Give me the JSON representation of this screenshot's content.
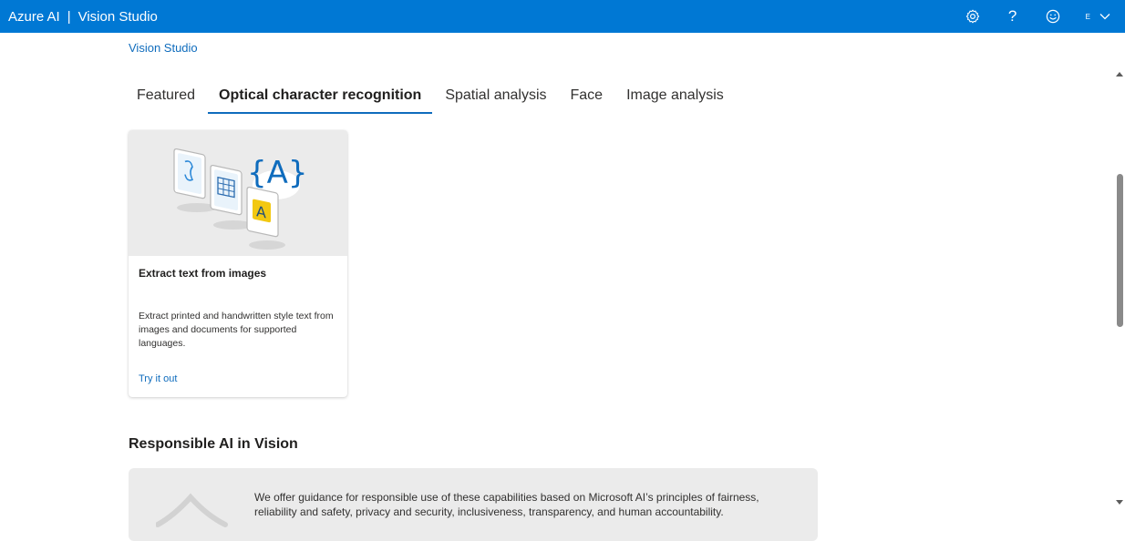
{
  "topbar": {
    "brand_left": "Azure AI",
    "separator": "|",
    "brand_right": "Vision Studio",
    "account_initial": "E",
    "icons": [
      "gear-icon",
      "help-icon",
      "feedback-smiley-icon",
      "chevron-down-icon"
    ]
  },
  "breadcrumb": {
    "label": "Vision Studio"
  },
  "tabs": [
    {
      "label": "Featured",
      "active": false
    },
    {
      "label": "Optical character recognition",
      "active": true
    },
    {
      "label": "Spatial analysis",
      "active": false
    },
    {
      "label": "Face",
      "active": false
    },
    {
      "label": "Image analysis",
      "active": false
    }
  ],
  "card": {
    "title": "Extract text from images",
    "description": "Extract printed and handwritten style text from images and documents for supported languages.",
    "link": "Try it out",
    "illustration_glyph": "{A}",
    "illustration_letter": "A"
  },
  "responsible": {
    "title": "Responsible AI in Vision",
    "text": "We offer guidance for responsible use of these capabilities based on Microsoft AI’s principles of fairness, reliability and safety, privacy and security, inclusiveness, transparency, and human accountability."
  },
  "colors": {
    "accent": "#0078d4",
    "link": "#0f6cbd",
    "card_image_bg": "#ebebeb"
  }
}
